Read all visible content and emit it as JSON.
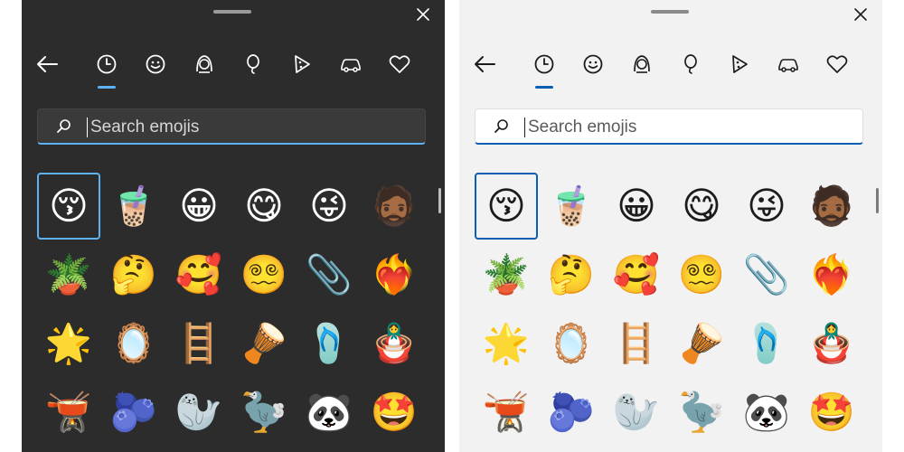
{
  "colors": {
    "dark_bg": "#2c2c2c",
    "light_bg": "#f2f2f2",
    "dark_accent": "#5fb2f2",
    "light_accent": "#0a5fb4"
  },
  "panels": [
    {
      "theme": "dark",
      "search": {
        "placeholder": "Search emojis",
        "value": ""
      },
      "nav": [
        {
          "icon": "back-arrow-icon"
        },
        {
          "icon": "recent-clock-icon",
          "active": true
        },
        {
          "icon": "smiley-icon"
        },
        {
          "icon": "person-icon"
        },
        {
          "icon": "balloon-icon"
        },
        {
          "icon": "pizza-icon"
        },
        {
          "icon": "car-icon"
        },
        {
          "icon": "heart-icon"
        }
      ],
      "emojis": [
        "😚",
        "🧋",
        "😀",
        "😋",
        "😜",
        "🧔🏾",
        "🪴",
        "🤔",
        "🥰",
        "😵‍💫",
        "📎",
        "❤️‍🔥",
        "🌟",
        "🪞",
        "🪜",
        "🪘",
        "🩴",
        "🪆",
        "🫕",
        "🫐",
        "🦭",
        "🦤",
        "🐼",
        "🤩"
      ],
      "selected_index": 0
    },
    {
      "theme": "light",
      "search": {
        "placeholder": "Search emojis",
        "value": ""
      },
      "nav": [
        {
          "icon": "back-arrow-icon"
        },
        {
          "icon": "recent-clock-icon",
          "active": true
        },
        {
          "icon": "smiley-icon"
        },
        {
          "icon": "person-icon"
        },
        {
          "icon": "balloon-icon"
        },
        {
          "icon": "pizza-icon"
        },
        {
          "icon": "car-icon"
        },
        {
          "icon": "heart-icon"
        }
      ],
      "emojis": [
        "😚",
        "🧋",
        "😀",
        "😋",
        "😜",
        "🧔🏾",
        "🪴",
        "🤔",
        "🥰",
        "😵‍💫",
        "📎",
        "❤️‍🔥",
        "🌟",
        "🪞",
        "🪜",
        "🪘",
        "🩴",
        "🪆",
        "🫕",
        "🫐",
        "🦭",
        "🦤",
        "🐼",
        "🤩"
      ],
      "selected_index": 0
    }
  ]
}
